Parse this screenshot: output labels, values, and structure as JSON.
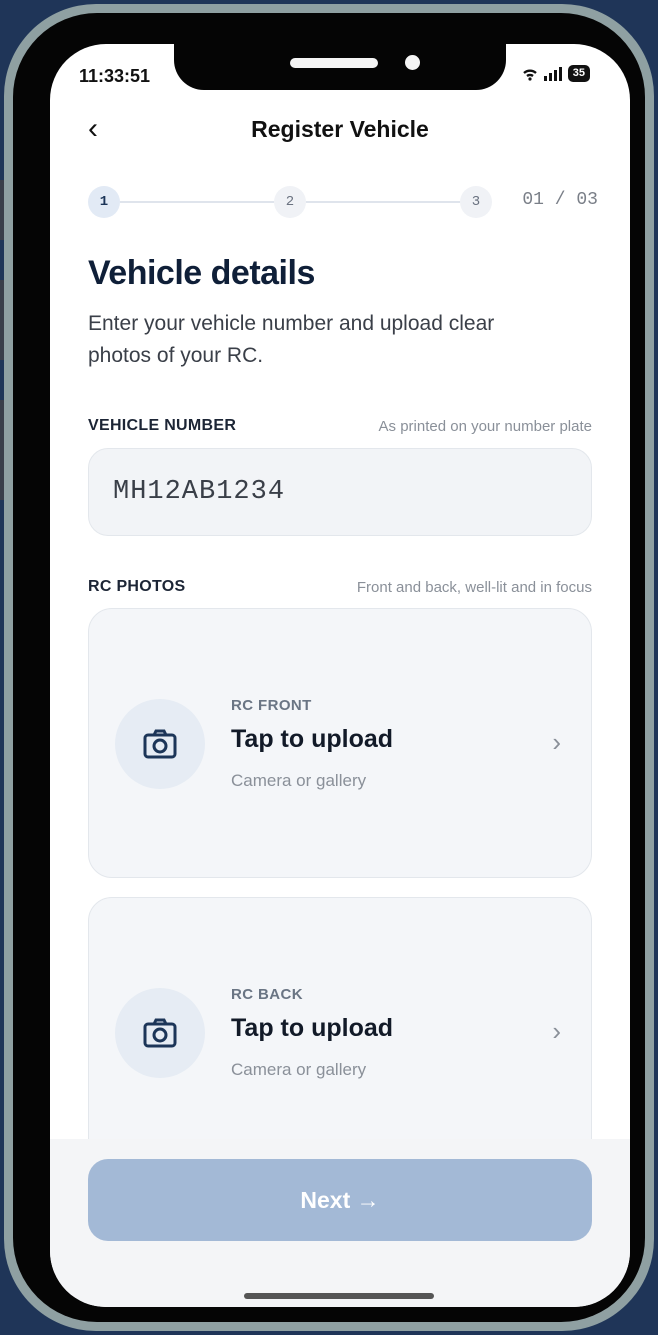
{
  "status_bar": {
    "time": "11:33:51",
    "battery": "35"
  },
  "header": {
    "back_icon": "‹",
    "title": "Register Vehicle"
  },
  "stepper": {
    "steps": [
      "1",
      "2",
      "3"
    ],
    "count": "01 / 03"
  },
  "intro": {
    "title": "Vehicle details",
    "subtitle": "Enter your vehicle number and upload clear photos of your RC."
  },
  "vehicle_number": {
    "label": "VEHICLE NUMBER",
    "hint": "As printed on your number plate",
    "value": "MH12AB1234"
  },
  "rc_photos": {
    "label": "RC PHOTOS",
    "hint": "Front and back, well-lit and in focus",
    "cards": [
      {
        "kicker": "RC FRONT",
        "title": "Tap to upload",
        "subtitle": "Camera or gallery",
        "chevron": "›"
      },
      {
        "kicker": "RC BACK",
        "title": "Tap to upload",
        "subtitle": "Camera or gallery",
        "chevron": "›"
      }
    ]
  },
  "footer": {
    "next_label": "Next →"
  },
  "colors": {
    "accent": "#1c3558",
    "button_disabled": "#a3b9d6",
    "card_bg": "#f4f6f9"
  }
}
